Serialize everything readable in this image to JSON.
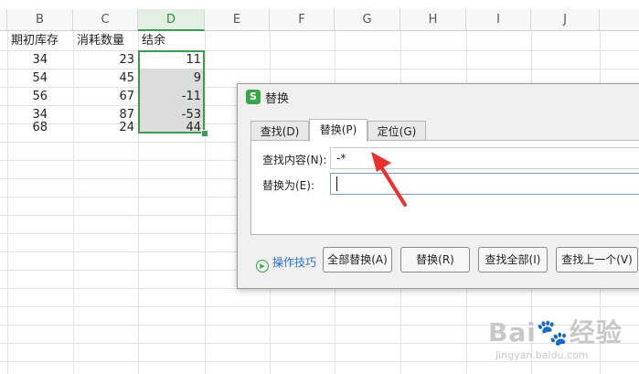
{
  "columns": [
    "B",
    "C",
    "D",
    "E",
    "F",
    "G",
    "H",
    "I",
    "J"
  ],
  "selected_column": "D",
  "table": {
    "headers": [
      "期初库存",
      "消耗数量",
      "结余"
    ],
    "rows": [
      [
        "34",
        "23",
        "11"
      ],
      [
        "54",
        "45",
        "9"
      ],
      [
        "56",
        "67",
        "-11"
      ],
      [
        "34",
        "87",
        "-53"
      ],
      [
        "68",
        "24",
        "44"
      ]
    ]
  },
  "dialog": {
    "app_icon": "S",
    "title": "替换",
    "tabs": [
      "查找(D)",
      "替换(P)",
      "定位(G)"
    ],
    "active_tab": "替换(P)",
    "find_label": "查找内容(N):",
    "find_value": "-*",
    "replace_label": "替换为(E):",
    "replace_value": "",
    "tips_label": "操作技巧",
    "buttons": [
      "全部替换(A)",
      "替换(R)",
      "查找全部(I)",
      "查找上一个(V)"
    ]
  },
  "annotation_color": "#e8322e",
  "accent_color": "#3e9a4f",
  "watermark": {
    "main": "Bai",
    "suffix": "经验",
    "url": "jingyan.baidu.com"
  }
}
